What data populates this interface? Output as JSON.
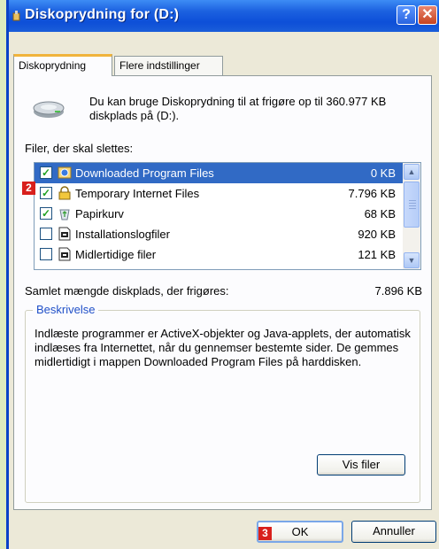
{
  "window": {
    "title": "Diskoprydning for  (D:)",
    "help_glyph": "?",
    "close_glyph": "✕"
  },
  "tabs": [
    {
      "label": "Diskoprydning",
      "active": true
    },
    {
      "label": "Flere indstillinger",
      "active": false
    }
  ],
  "intro_text": "Du kan bruge Diskoprydning til at frigøre op til 360.977 KB diskplads på  (D:).",
  "files_label": "Filer, der skal slettes:",
  "files": [
    {
      "name": "Downloaded Program Files",
      "size": "0 KB",
      "checked": true,
      "selected": true,
      "icon": "downloaded-files-icon"
    },
    {
      "name": "Temporary Internet Files",
      "size": "7.796 KB",
      "checked": true,
      "selected": false,
      "icon": "lock-icon"
    },
    {
      "name": "Papirkurv",
      "size": "68 KB",
      "checked": true,
      "selected": false,
      "icon": "recycle-bin-icon"
    },
    {
      "name": "Installationslogfiler",
      "size": "920 KB",
      "checked": false,
      "selected": false,
      "icon": "log-file-icon"
    },
    {
      "name": "Midlertidige filer",
      "size": "121 KB",
      "checked": false,
      "selected": false,
      "icon": "temp-file-icon"
    }
  ],
  "scroll": {
    "up": "▲",
    "down": "▼"
  },
  "total": {
    "label": "Samlet mængde diskplads, der frigøres:",
    "value": "7.896 KB"
  },
  "description": {
    "legend": "Beskrivelse",
    "text": "Indlæste programmer er ActiveX-objekter og Java-applets, der automatisk indlæses fra Internettet, når du gennemser bestemte sider. De gemmes midlertidigt i mappen Downloaded Program Files på harddisken."
  },
  "buttons": {
    "view_files": "Vis filer",
    "ok": "OK",
    "cancel": "Annuller"
  },
  "badges": {
    "list": "2",
    "ok": "3"
  },
  "colors": {
    "selection": "#316ac5",
    "titlebar": "#0d4fd8",
    "badge": "#d8201c",
    "page_background": "#dcebbf"
  }
}
